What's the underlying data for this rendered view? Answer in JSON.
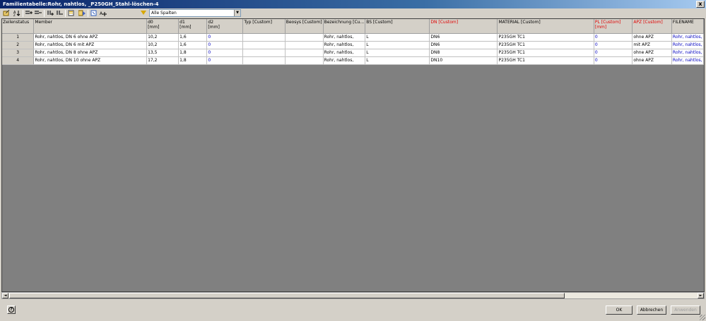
{
  "window": {
    "title": "Familientabelle:Rohr, nahtlos, _P250GH_Stahl-löschen-4",
    "close_label": "x"
  },
  "toolbar": {
    "icons": [
      "edit-icon",
      "sort-icon",
      "insert-row-icon",
      "delete-row-icon",
      "insert-column-icon",
      "delete-column-icon",
      "properties-icon",
      "export-icon",
      "refresh-icon",
      "add-icon"
    ],
    "filter_icon": "filter-icon",
    "column_filter_value": "Alle Spalten",
    "dropdown_arrow": "▼"
  },
  "table": {
    "headers": [
      {
        "label": "Zeilenstatus",
        "unit": ""
      },
      {
        "label": "Member",
        "unit": ""
      },
      {
        "label": "d0",
        "unit": "[mm]"
      },
      {
        "label": "d1",
        "unit": "[mm]"
      },
      {
        "label": "d2",
        "unit": "[mm]"
      },
      {
        "label": "Typ [Custom]",
        "unit": ""
      },
      {
        "label": "Beosys [Custom]",
        "unit": ""
      },
      {
        "label": "Bezeichnung  [Cu...",
        "unit": ""
      },
      {
        "label": "BS [Custom]",
        "unit": ""
      },
      {
        "label": "DN [Custom]",
        "unit": ""
      },
      {
        "label": "MATERIAL [Custom]",
        "unit": ""
      },
      {
        "label": "PL [Custom]",
        "unit": "[mm]"
      },
      {
        "label": "APZ [Custom]",
        "unit": ""
      },
      {
        "label": "FILENAME",
        "unit": ""
      }
    ],
    "red_headers": [
      9,
      11,
      12
    ],
    "rows": [
      [
        "1",
        "Rohr, nahtlos, DN 6 ohne APZ",
        "10,2",
        "1,6",
        "0",
        "",
        "",
        "Rohr, nahtlos,",
        "L",
        "DN6",
        "P235GH TC1",
        "0",
        "ohne APZ",
        "Rohr, nahtlos,"
      ],
      [
        "2",
        "Rohr, nahtlos, DN 6 mit APZ",
        "10,2",
        "1,6",
        "0",
        "",
        "",
        "Rohr, nahtlos,",
        "L",
        "DN6",
        "P235GH TC1",
        "0",
        "mit APZ",
        "Rohr, nahtlos,"
      ],
      [
        "3",
        "Rohr, nahtlos, DN 8 ohne APZ",
        "13,5",
        "1,8",
        "0",
        "",
        "",
        "Rohr, nahtlos,",
        "L",
        "DN8",
        "P235GH TC1",
        "0",
        "ohne APZ",
        "Rohr, nahtlos,"
      ],
      [
        "4",
        "Rohr, nahtlos, DN 10 ohne APZ",
        "17,2",
        "1,8",
        "0",
        "",
        "",
        "Rohr, nahtlos,",
        "L",
        "DN10",
        "P235GH TC1",
        "0",
        "ohne APZ",
        "Rohr, nahtlos,"
      ]
    ],
    "blue_columns": [
      4,
      11,
      13
    ]
  },
  "scrollbar": {
    "left_arrow": "◄",
    "right_arrow": "►"
  },
  "buttons": {
    "help": "?",
    "ok": "OK",
    "cancel": "Abbrechen",
    "apply": "Anwenden"
  },
  "colors": {
    "red_header": "#e00000",
    "blue_value": "#0000c0",
    "title_bar": "#0a246a"
  }
}
